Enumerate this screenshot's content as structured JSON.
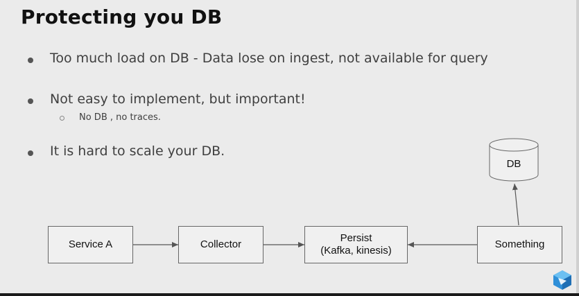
{
  "slide": {
    "title": "Protecting you DB",
    "bullets": [
      "Too much load on DB - Data lose on ingest, not available for query",
      "Not easy to implement, but important!",
      "It is hard to scale your DB."
    ],
    "sub_bullet": "No DB , no traces."
  },
  "diagram": {
    "nodes": {
      "service_a": "Service A",
      "collector": "Collector",
      "persist_line1": "Persist",
      "persist_line2": "(Kafka, kinesis)",
      "something": "Something",
      "db": "DB"
    }
  },
  "colors": {
    "background": "#ebebeb",
    "box_fill": "#f0f0f0",
    "box_border": "#666666",
    "logo": "#2f8fd8"
  },
  "icons": {
    "logo": "cube-logo-icon"
  }
}
